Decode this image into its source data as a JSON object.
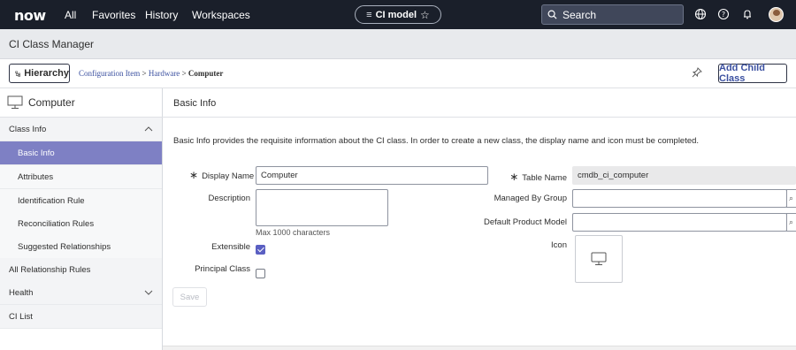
{
  "topnav": {
    "logo": "now",
    "links": [
      "All",
      "Favorites",
      "History",
      "Workspaces"
    ],
    "context_pill": "CI model",
    "search_placeholder": "Search"
  },
  "titlebar": {
    "title": "CI Class Manager"
  },
  "breadcrumb": {
    "hierarchy_button": "Hierarchy",
    "crumb_1": "Configuration Item",
    "sep": ">",
    "crumb_2": "Hardware",
    "crumb_3": "Computer",
    "add_child_button": "Add Child Class"
  },
  "sidebar": {
    "class_name": "Computer",
    "items": [
      {
        "label": "Class Info"
      },
      {
        "label": "Basic Info"
      },
      {
        "label": "Attributes"
      },
      {
        "label": "Identification Rule"
      },
      {
        "label": "Reconciliation Rules"
      },
      {
        "label": "Suggested Relationships"
      },
      {
        "label": "All Relationship Rules"
      },
      {
        "label": "Health"
      },
      {
        "label": "CI List"
      }
    ]
  },
  "main": {
    "section_title": "Basic Info",
    "intro": "Basic Info provides the requisite information about the CI class. In order to create a new class, the display name and icon must be completed.",
    "display_name_label": "Display Name",
    "display_name_value": "Computer",
    "description_label": "Description",
    "description_hint": "Max 1000 characters",
    "extensible_label": "Extensible",
    "extensible_checked": true,
    "principal_class_label": "Principal Class",
    "principal_class_checked": false,
    "table_name_label": "Table Name",
    "table_name_value": "cmdb_ci_computer",
    "managed_by_group_label": "Managed By Group",
    "default_product_model_label": "Default Product Model",
    "icon_label": "Icon",
    "icon_name": "computer-monitor-icon",
    "save_button": "Save"
  },
  "colors": {
    "topnav_bg": "#1a1f2a",
    "active_item_bg": "#7e80c4",
    "checkbox_on": "#5a5fc2",
    "link": "#3b50a0"
  }
}
